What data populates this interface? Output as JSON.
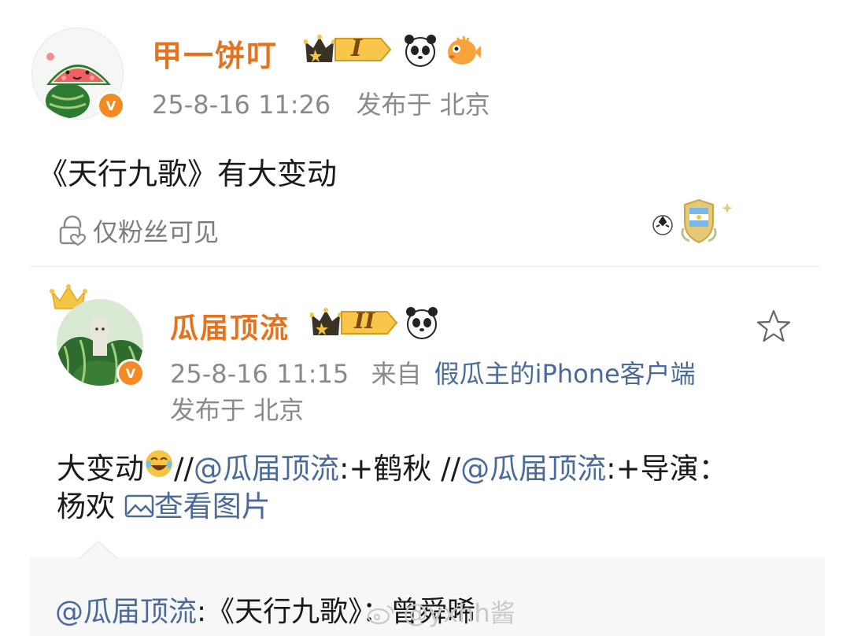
{
  "post": {
    "username": "甲一饼叮",
    "level_badge": "I",
    "time": "25-8-16 11:26",
    "location": "发布于 北京",
    "text": "《天行九歌》有大变动",
    "visibility": "仅粉丝可见"
  },
  "repost": {
    "username": "瓜届顶流",
    "level_badge": "II",
    "time": "25-8-16 11:15",
    "source_prefix": "来自",
    "source": "假瓜主的iPhone客户端",
    "location": "发布于 北京",
    "text_parts": {
      "p1": "大变动",
      "p2": "//",
      "mention1": "@瓜届顶流",
      "p3": ":+鹤秋 //",
      "mention2": "@瓜届顶流",
      "p4": ":+导演：",
      "p5": "杨欢 ",
      "view_image": "查看图片"
    }
  },
  "comment": {
    "mention": "@瓜届顶流",
    "text": ":《天行九歌》：曾舜晞"
  },
  "watermark": {
    "text": "@yxhh酱"
  },
  "colors": {
    "username": "#e5731e",
    "link": "#4a6b99",
    "meta": "#8a8a8a",
    "verified": "#f48a24"
  }
}
